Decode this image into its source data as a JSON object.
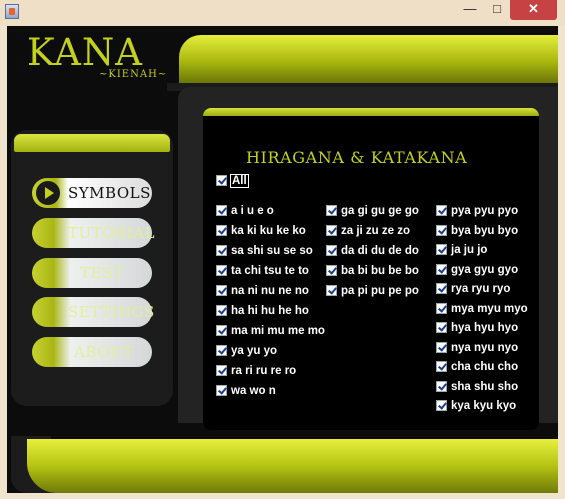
{
  "window": {
    "minimize": "—",
    "maximize": "□",
    "close": "✕"
  },
  "logo": {
    "title": "KANA",
    "subtitle": "~KIENAH~"
  },
  "nav": [
    {
      "label": "SYMBOLS",
      "active": true
    },
    {
      "label": "TUTORIAL",
      "active": false
    },
    {
      "label": "TEST",
      "active": false
    },
    {
      "label": "SETTINGS",
      "active": false
    },
    {
      "label": "ABOUT",
      "active": false
    }
  ],
  "main": {
    "heading": "HIRAGANA & KATAKANA",
    "all_label": "All",
    "col1": [
      "a i u e o",
      "ka ki ku ke ko",
      "sa shi su se so",
      "ta chi tsu te to",
      "na ni nu ne no",
      "ha hi hu he ho",
      "ma mi mu me mo",
      "ya yu yo",
      "ra ri ru re ro",
      "wa wo n"
    ],
    "col2": [
      "ga gi gu ge go",
      "za ji zu ze zo",
      "da di du de do",
      "ba bi bu be bo",
      "pa pi pu pe po"
    ],
    "col3": [
      "pya pyu pyo",
      "bya byu byo",
      "ja ju jo",
      "gya gyu gyo",
      "rya ryu ryo",
      "mya myu myo",
      "hya hyu hyo",
      "nya nyu nyo",
      "cha chu cho",
      "sha shu sho",
      "kya kyu kyo"
    ]
  }
}
